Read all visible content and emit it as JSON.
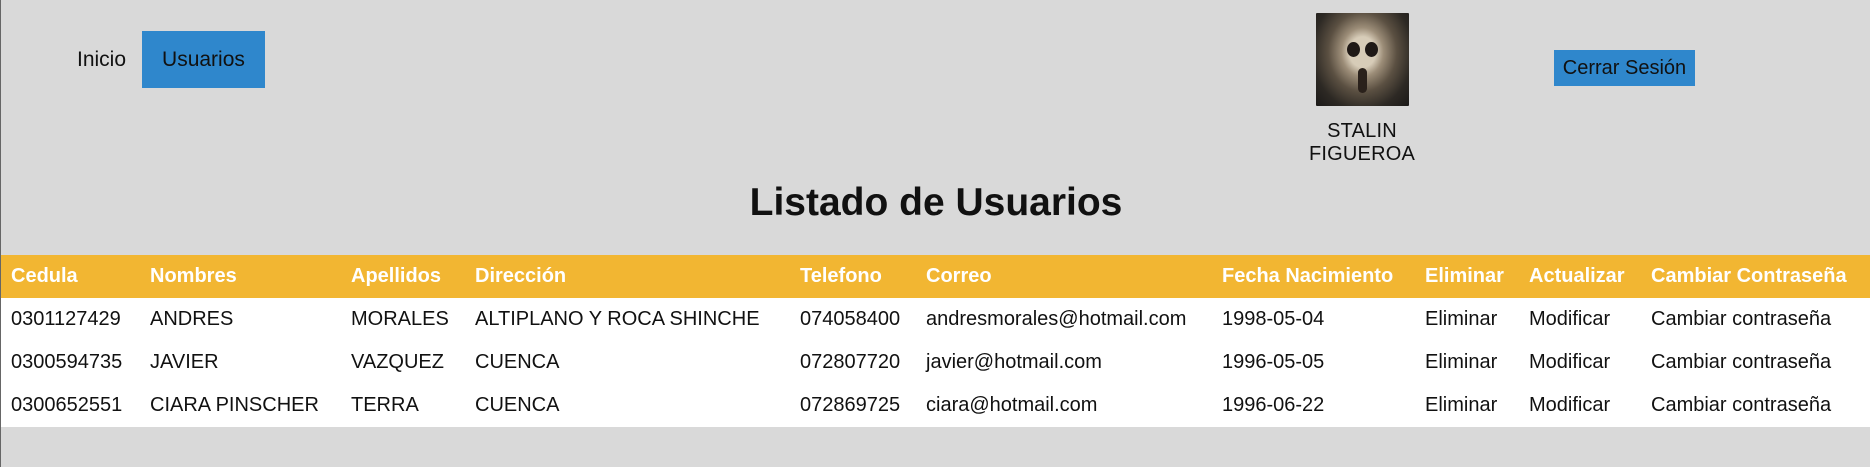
{
  "nav": {
    "items": [
      {
        "label": "Inicio"
      },
      {
        "label": "Usuarios"
      }
    ]
  },
  "user": {
    "name": "STALIN FIGUEROA"
  },
  "header": {
    "logout_label": "Cerrar Sesión"
  },
  "page": {
    "title": "Listado de Usuarios"
  },
  "table": {
    "columns": [
      "Cedula",
      "Nombres",
      "Apellidos",
      "Dirección",
      "Telefono",
      "Correo",
      "Fecha Nacimiento",
      "Eliminar",
      "Actualizar",
      "Cambiar Contraseña"
    ],
    "rows": [
      {
        "cedula": "0301127429",
        "nombres": "ANDRES",
        "apellidos": "MORALES",
        "direccion": "ALTIPLANO Y ROCA SHINCHE",
        "telefono": "074058400",
        "correo": "andresmorales@hotmail.com",
        "fecha": "1998-05-04",
        "eliminar": "Eliminar",
        "actualizar": "Modificar",
        "cambiar": "Cambiar contraseña"
      },
      {
        "cedula": "0300594735",
        "nombres": "JAVIER",
        "apellidos": "VAZQUEZ",
        "direccion": "CUENCA",
        "telefono": "072807720",
        "correo": "javier@hotmail.com",
        "fecha": "1996-05-05",
        "eliminar": "Eliminar",
        "actualizar": "Modificar",
        "cambiar": "Cambiar contraseña"
      },
      {
        "cedula": "0300652551",
        "nombres": "CIARA PINSCHER",
        "apellidos": "TERRA",
        "direccion": "CUENCA",
        "telefono": "072869725",
        "correo": "ciara@hotmail.com",
        "fecha": "1996-06-22",
        "eliminar": "Eliminar",
        "actualizar": "Modificar",
        "cambiar": "Cambiar contraseña"
      }
    ]
  },
  "colors": {
    "background": "#d9d9d9",
    "accent_blue": "#2f87cc",
    "table_header": "#f2b632"
  },
  "icons": {
    "avatar": "user-avatar-image"
  }
}
